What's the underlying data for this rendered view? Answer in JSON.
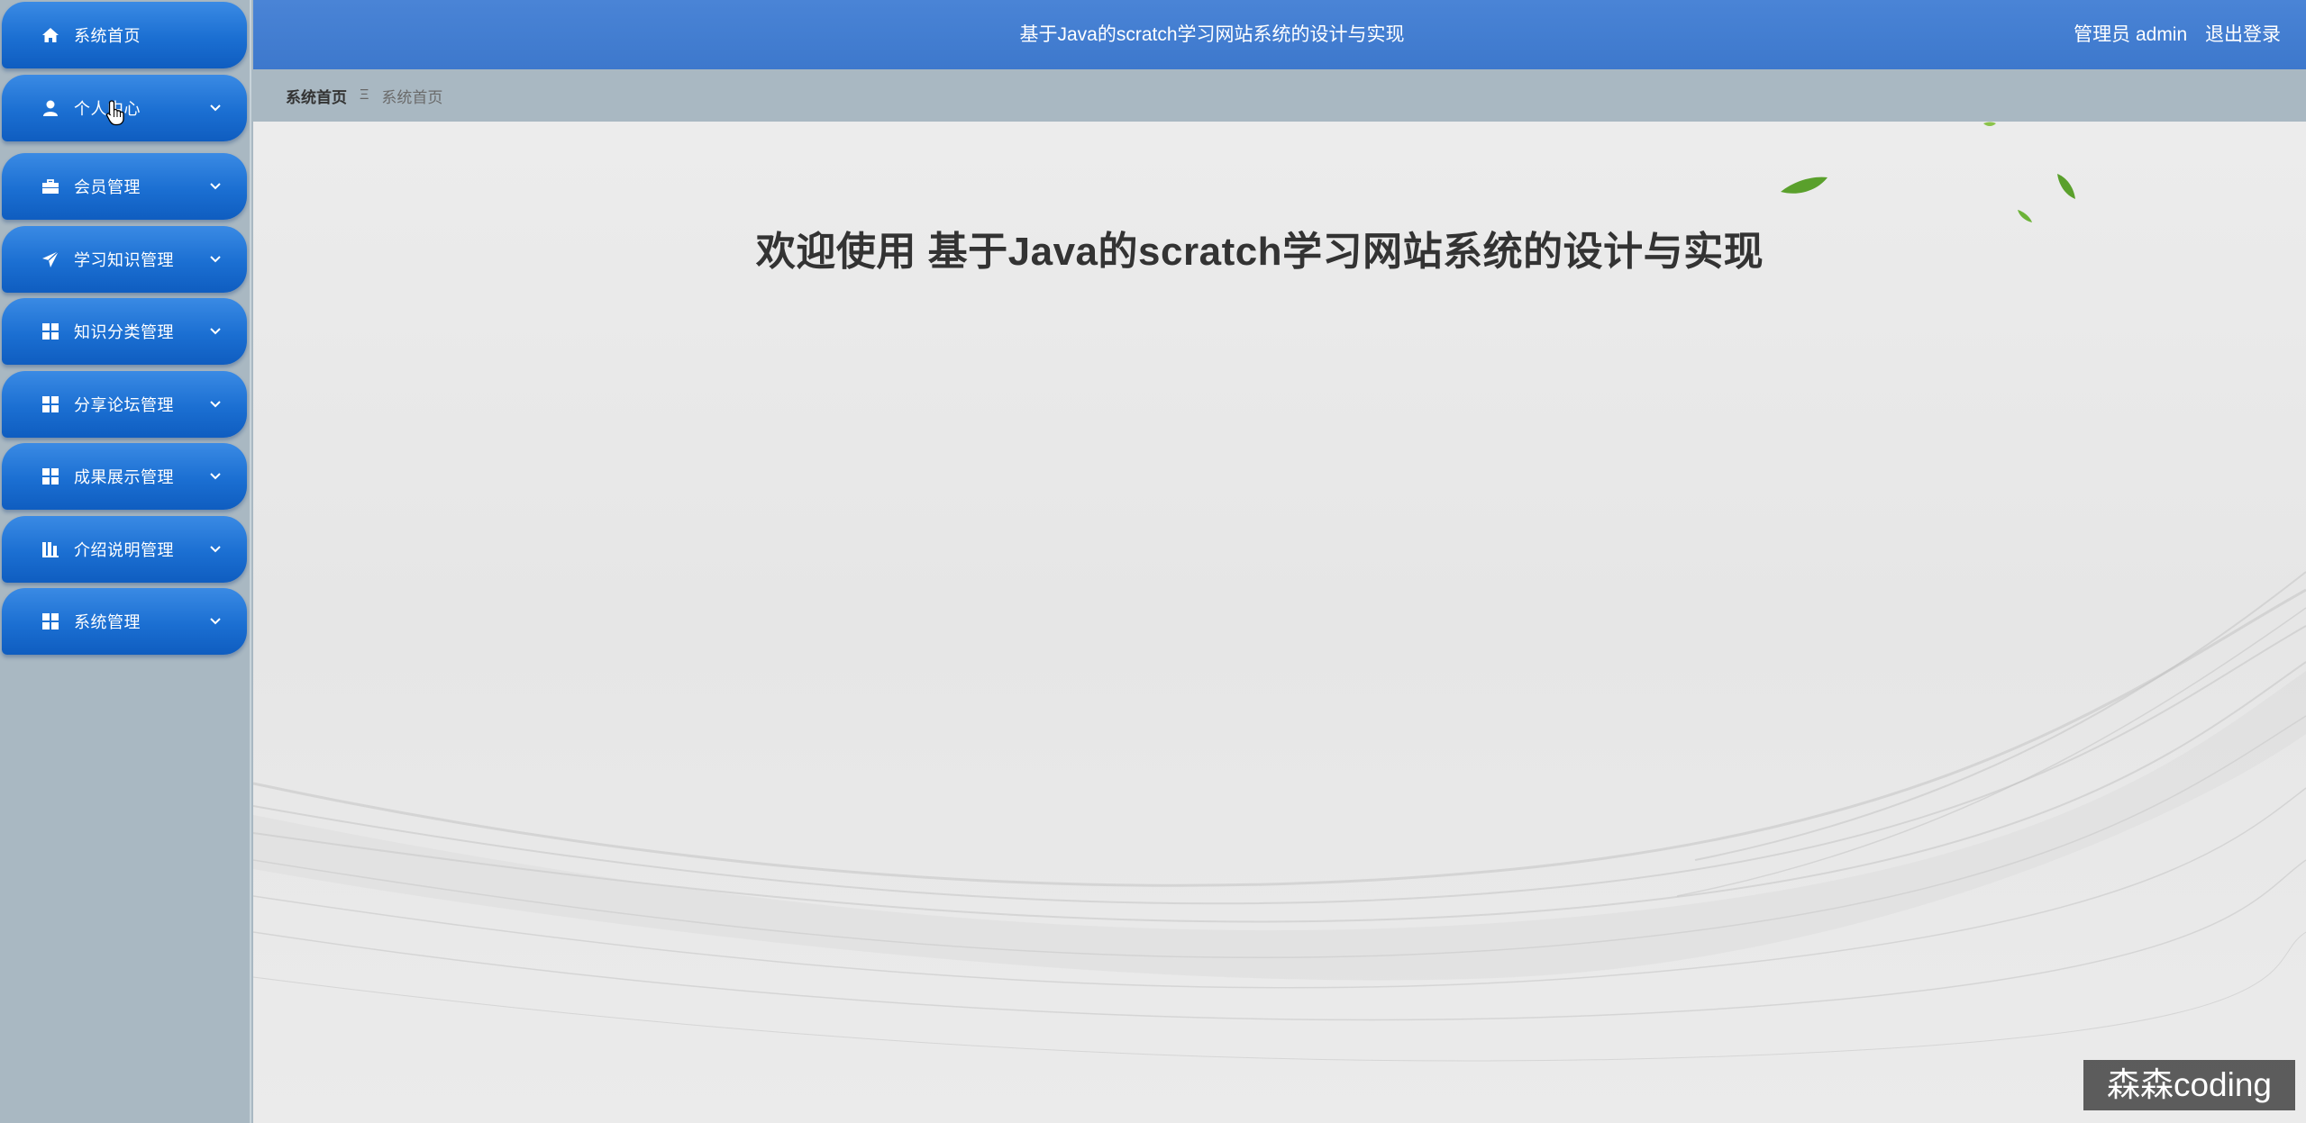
{
  "header": {
    "title": "基于Java的scratch学习网站系统的设计与实现",
    "user_label": "管理员 admin",
    "logout_label": "退出登录"
  },
  "breadcrumb": {
    "root": "系统首页",
    "separator": "Ξ",
    "current": "系统首页"
  },
  "sidebar": {
    "items": [
      {
        "label": "系统首页",
        "icon": "home-icon",
        "has_submenu": false
      },
      {
        "label": "个人中心",
        "icon": "user-icon",
        "has_submenu": true
      },
      {
        "label": "会员管理",
        "icon": "briefcase-icon",
        "has_submenu": true
      },
      {
        "label": "学习知识管理",
        "icon": "paper-plane-icon",
        "has_submenu": true
      },
      {
        "label": "知识分类管理",
        "icon": "grid-icon",
        "has_submenu": true
      },
      {
        "label": "分享论坛管理",
        "icon": "grid-icon",
        "has_submenu": true
      },
      {
        "label": "成果展示管理",
        "icon": "grid-icon",
        "has_submenu": true
      },
      {
        "label": "介绍说明管理",
        "icon": "bar-chart-icon",
        "has_submenu": true
      },
      {
        "label": "系统管理",
        "icon": "grid-icon",
        "has_submenu": true
      }
    ]
  },
  "main": {
    "welcome": "欢迎使用 基于Java的scratch学习网站系统的设计与实现"
  },
  "watermark": {
    "text": "森森coding"
  },
  "colors": {
    "header_bg": "#4a84d6",
    "nav_button": "#1b6fd2",
    "sidebar_bg": "#a9b8c2",
    "content_bg": "#e8e8e8",
    "title_text": "#333333",
    "leaf_green": "#5aa02c"
  }
}
